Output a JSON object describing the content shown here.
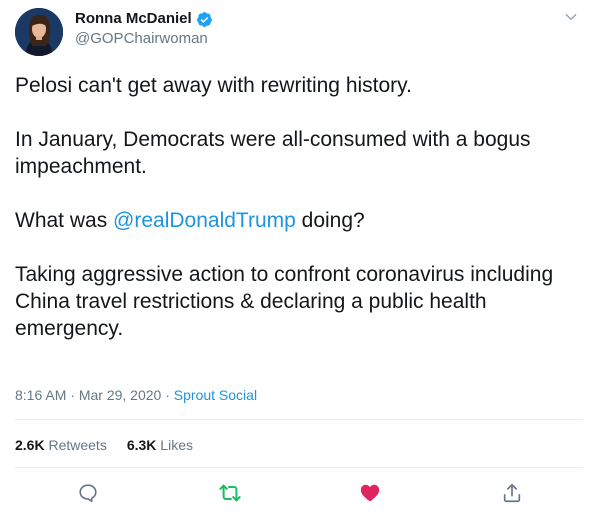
{
  "author": {
    "display_name": "Ronna McDaniel",
    "handle": "@GOPChairwoman",
    "verified": true
  },
  "tweet": {
    "paragraphs": {
      "p1": "Pelosi can't get away with rewriting history.",
      "p2": "In January, Democrats were all-consumed with a bogus impeachment.",
      "p3_before": "What was ",
      "p3_mention": "@realDonaldTrump",
      "p3_after": " doing?",
      "p4": "Taking aggressive action to confront coronavirus including China travel restrictions & declaring a public health emergency."
    }
  },
  "meta": {
    "time": "8:16 AM",
    "sep1": " · ",
    "date": "Mar 29, 2020",
    "sep2": " · ",
    "source": "Sprout Social"
  },
  "stats": {
    "retweets_count": "2.6K",
    "retweets_label": " Retweets",
    "likes_count": "6.3K",
    "likes_label": " Likes"
  },
  "actions": {
    "reply_icon": "reply-icon",
    "retweet_icon": "retweet-icon",
    "like_icon": "heart-icon",
    "share_icon": "share-icon"
  },
  "colors": {
    "link": "#1b95e0",
    "retweet": "#17bf63",
    "like": "#e0245e",
    "muted": "#657786",
    "verified": "#1da1f2"
  }
}
